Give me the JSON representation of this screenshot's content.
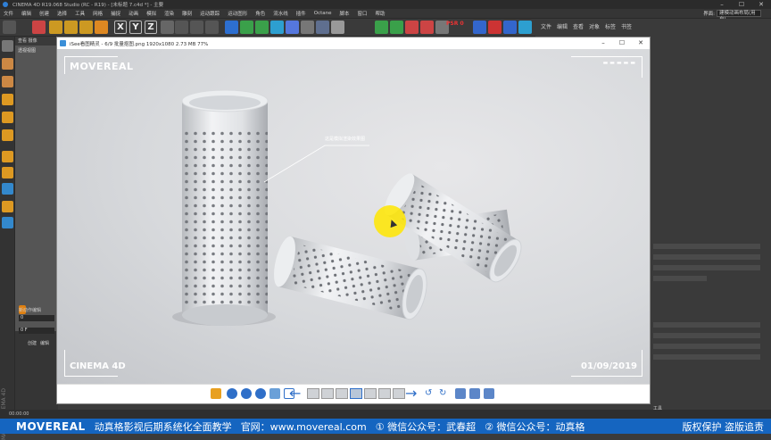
{
  "c4d": {
    "title": "CINEMA 4D R19.068 Studio (RC - R19) - [未标题 7.c4d *] - 主要",
    "menu": [
      "文件",
      "编辑",
      "创建",
      "选择",
      "工具",
      "网格",
      "捕捉",
      "动画",
      "模拟",
      "渲染",
      "雕刻",
      "运动跟踪",
      "运动图形",
      "角色",
      "流水线",
      "插件",
      "Octane",
      "脚本",
      "窗口",
      "帮助"
    ],
    "layout_label": "界面:",
    "layout_value": "建模动画布局(用户)",
    "axis_buttons": [
      "X",
      "Y",
      "Z"
    ],
    "right_tabs": [
      "文件",
      "编辑",
      "查看",
      "对象",
      "标签",
      "书签"
    ],
    "viewport_menu": "查看  摄像",
    "viewport_label": "透视视图",
    "maxon_text": "MAXON CINEMA 4D",
    "attr_label": "工具",
    "timeline_value1": "0",
    "timeline_value2": "0 F",
    "timeline_tabs": [
      "创建",
      "编辑"
    ],
    "timeline_label": "新动作编辑",
    "timecode": "00:00:00",
    "psr_label": "PSR",
    "psr_value": "0"
  },
  "viewer": {
    "title": "iSee看图精灵 - 6/9   批量抠图.png   1920x1080   2.73 MB   77%",
    "brand": "MOVEREAL",
    "logo_bottom": "CINEMA 4D",
    "date": "01/09/2019",
    "annotation": "这是模拟渲染效果图",
    "minimize": "–",
    "maximize": "☐",
    "close": "✕"
  },
  "banner": {
    "logo": "MOVEREAL",
    "text1": "动真格影视后期系统化全面教学",
    "text2": "官网：www.movereal.com",
    "text3": "① 微信公众号：武春超",
    "text4": "② 微信公众号：动真格",
    "text5": "版权保护  盗版追责"
  },
  "colors": {
    "banner_bg": "#1565c0",
    "cursor": "#ffe600",
    "c4d_bg": "#3b3b3b"
  }
}
